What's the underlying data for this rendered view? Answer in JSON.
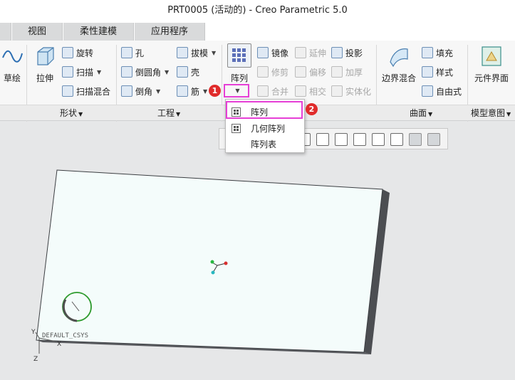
{
  "window": {
    "title": "PRT0005 (活动的) - Creo Parametric 5.0"
  },
  "tabs": [
    {
      "label": "视图"
    },
    {
      "label": "柔性建模"
    },
    {
      "label": "应用程序"
    }
  ],
  "ribbon": {
    "sketch": {
      "label": "草绘"
    },
    "shape": {
      "extrude": "拉伸",
      "revolve": "旋转",
      "sweep": "扫描",
      "swept_blend": "扫描混合",
      "group_label": "形状"
    },
    "engineering": {
      "hole": "孔",
      "round": "倒圆角",
      "chamfer": "倒角",
      "draft": "拔模",
      "shell": "壳",
      "rib": "筋",
      "group_label": "工程"
    },
    "editing": {
      "pattern": "阵列",
      "mirror": "镜像",
      "extend": "延伸",
      "project": "投影",
      "trim": "修剪",
      "offset": "偏移",
      "thicken": "加厚",
      "merge": "合并",
      "intersect": "相交",
      "solidify": "实体化"
    },
    "surfaces": {
      "boundary_blend": "边界混合",
      "fill": "填充",
      "style": "样式",
      "freestyle": "自由式",
      "group_label": "曲面"
    },
    "model_intent": {
      "component_interface": "元件界面",
      "group_label": "模型意图"
    }
  },
  "pattern_menu": {
    "items": [
      {
        "label": "阵列"
      },
      {
        "label": "几何阵列"
      },
      {
        "label": "阵列表"
      }
    ]
  },
  "annotations": {
    "badge1": "1",
    "badge2": "2",
    "highlight_color": "#e63fd6",
    "badge_color": "#e02b2b"
  },
  "model": {
    "csys_label": "DEFAULT_CSYS",
    "axis_x": "X",
    "axis_y": "Y",
    "axis_z": "Z"
  },
  "colors": {
    "plate_face": "#f4fcfb",
    "plate_edge": "#4c4e52",
    "circle": "#2e9b2e"
  }
}
